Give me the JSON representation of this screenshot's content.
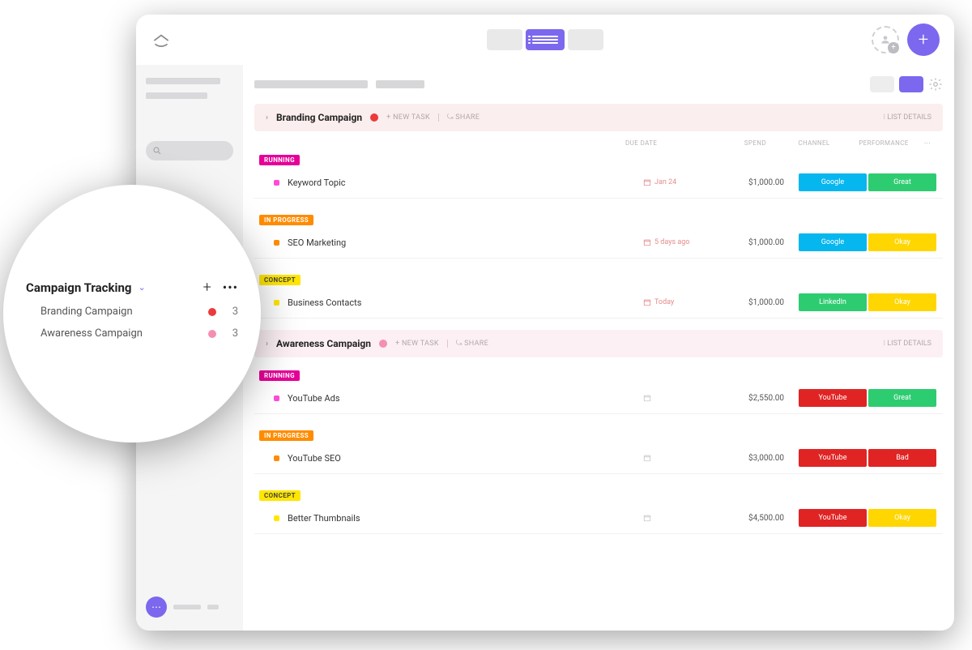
{
  "header": {
    "new_task": "+ NEW TASK",
    "share": "SHARE",
    "list_details": "LIST DETAILS"
  },
  "columns": {
    "due": "DUE DATE",
    "spend": "SPEND",
    "channel": "CHANNEL",
    "performance": "PERFORMANCE"
  },
  "statuses": {
    "running": "RUNNING",
    "in_progress": "IN PROGRESS",
    "concept": "CONCEPT"
  },
  "groups": [
    {
      "title": "Branding Campaign",
      "dot": "red",
      "tasks": [
        {
          "status": "running",
          "name": "Keyword Topic",
          "due": "Jan 24",
          "due_gray": false,
          "spend": "$1,000.00",
          "channel": "Google",
          "channel_class": "chip-google",
          "perf": "Great",
          "perf_class": "chip-great"
        },
        {
          "status": "in_progress",
          "name": "SEO Marketing",
          "due": "5 days ago",
          "due_gray": false,
          "spend": "$1,000.00",
          "channel": "Google",
          "channel_class": "chip-google",
          "perf": "Okay",
          "perf_class": "chip-okay"
        },
        {
          "status": "concept",
          "name": "Business Contacts",
          "due": "Today",
          "due_gray": false,
          "spend": "$1,000.00",
          "channel": "LinkedIn",
          "channel_class": "chip-linkedin",
          "perf": "Okay",
          "perf_class": "chip-okay"
        }
      ]
    },
    {
      "title": "Awareness Campaign",
      "dot": "pink",
      "tasks": [
        {
          "status": "running",
          "name": "YouTube Ads",
          "due": "",
          "due_gray": true,
          "spend": "$2,550.00",
          "channel": "YouTube",
          "channel_class": "chip-youtube",
          "perf": "Great",
          "perf_class": "chip-great"
        },
        {
          "status": "in_progress",
          "name": "YouTube SEO",
          "due": "",
          "due_gray": true,
          "spend": "$3,000.00",
          "channel": "YouTube",
          "channel_class": "chip-youtube",
          "perf": "Bad",
          "perf_class": "chip-bad"
        },
        {
          "status": "concept",
          "name": "Better Thumbnails",
          "due": "",
          "due_gray": true,
          "spend": "$4,500.00",
          "channel": "YouTube",
          "channel_class": "chip-youtube",
          "perf": "Okay",
          "perf_class": "chip-okay"
        }
      ]
    }
  ],
  "zoom": {
    "title": "Campaign Tracking",
    "items": [
      {
        "label": "Branding Campaign",
        "dot": "red",
        "count": "3"
      },
      {
        "label": "Awareness Campaign",
        "dot": "pink",
        "count": "3"
      }
    ]
  }
}
